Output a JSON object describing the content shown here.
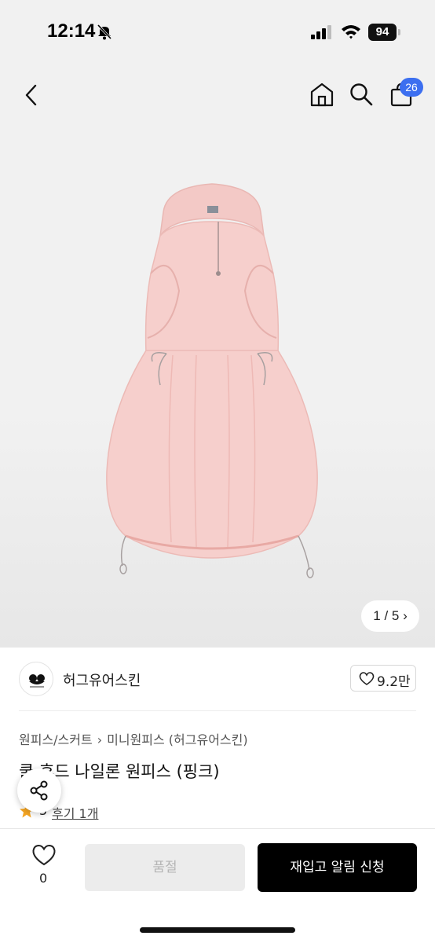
{
  "status_bar": {
    "time": "12:14",
    "battery": "94"
  },
  "header": {
    "cart_count": "26"
  },
  "gallery": {
    "pager": "1 / 5 ›"
  },
  "brand": {
    "name": "허그유어스킨",
    "like_count": "9.2만"
  },
  "product": {
    "category": "원피스/스커트",
    "subcategory": "미니원피스 (허그유어스킨)",
    "breadcrumb_separator": "›",
    "title": "쿨 후드 나일론 원피스 (핑크)",
    "rating": "5",
    "review_link": "후기 1개"
  },
  "bottom_bar": {
    "wish_count": "0",
    "soldout_label": "품절",
    "restock_label": "재입고 알림 신청"
  },
  "colors": {
    "accent_badge": "#3c6ff0",
    "dress": "#f6cfcc",
    "star": "#f5a623"
  }
}
